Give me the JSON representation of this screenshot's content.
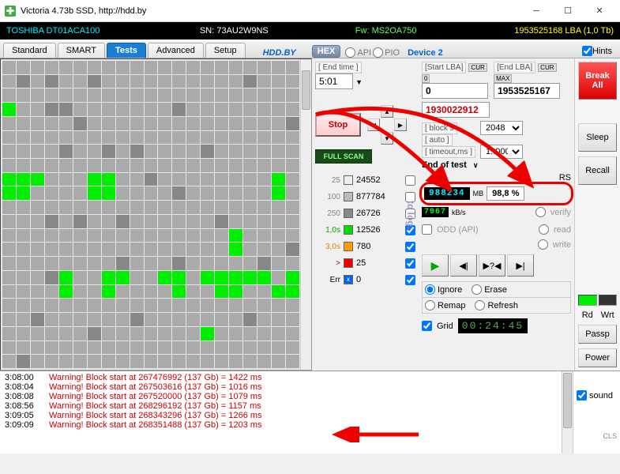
{
  "window": {
    "title": "Victoria 4.73b SSD, http://hdd.by"
  },
  "drive": {
    "model": "TOSHIBA DT01ACA100",
    "sn_label": "SN:",
    "sn": "73AU2W9NS",
    "fw_label": "Fw:",
    "fw": "MS2OA750",
    "lba": "1953525168 LBA (1,0 Tb)"
  },
  "tabs": {
    "standard": "Standard",
    "smart": "SMART",
    "tests": "Tests",
    "advanced": "Advanced",
    "setup": "Setup"
  },
  "top": {
    "hdd_by": "HDD.BY",
    "hex": "HEX",
    "api": "API",
    "pio": "PIO",
    "device": "Device 2",
    "hints": "Hints"
  },
  "scan": {
    "start_lba_label": "[Start LBA]",
    "end_lba_label": "[End LBA]",
    "end_time_label": "[ End time ]",
    "end_time": "5:01",
    "start_lba": "0",
    "end_lba": "1953525167",
    "pos_lba": "1930022912",
    "cur": "CUR",
    "zero": "0",
    "max": "MAX",
    "block_label": "[ block s",
    "auto_label": "[ auto ]",
    "timeout_label": "[ timeout,ms ]",
    "block": "2048",
    "timeout": "1..000",
    "stop": "Stop",
    "full_scan": "FULL SCAN",
    "end_of_test": "End of test"
  },
  "stats": {
    "l25": {
      "label": "25",
      "value": "24552"
    },
    "l100": {
      "label": "100",
      "value": "877784"
    },
    "l250": {
      "label": "250",
      "value": "26726"
    },
    "l1s": {
      "label": "1,0s",
      "value": "12526"
    },
    "l3s": {
      "label": "3,0s",
      "value": "780"
    },
    "lgt": {
      "label": ">",
      "value": "25"
    },
    "lerr": {
      "label": "Err",
      "value": "0"
    },
    "tolog": "to log:",
    "rs": "RS"
  },
  "result": {
    "mb": "988234",
    "mb_unit": "MB",
    "percent": "98,8  %",
    "kbs": "7967",
    "kbs_unit": "kB/s"
  },
  "opts": {
    "verify": "verify",
    "read": "read",
    "write": "write",
    "odd": "ODD (API)",
    "ignore": "Ignore",
    "erase": "Erase",
    "remap": "Remap",
    "refresh": "Refresh",
    "grid": "Grid",
    "timer": "00:24:45"
  },
  "side": {
    "break": "Break",
    "all": "All",
    "sleep": "Sleep",
    "recall": "Recall",
    "passp": "Passp",
    "power": "Power",
    "rd": "Rd",
    "wrt": "Wrt",
    "sound": "sound",
    "cls": "CLS"
  },
  "log": [
    {
      "t": "3:08:00",
      "m": "Warning! Block start at 267476992 (137 Gb)  = 1422 ms"
    },
    {
      "t": "3:08:04",
      "m": "Warning! Block start at 267503616 (137 Gb)  = 1016 ms"
    },
    {
      "t": "3:08:08",
      "m": "Warning! Block start at 267520000 (137 Gb)  = 1079 ms"
    },
    {
      "t": "3:08:56",
      "m": "Warning! Block start at 268296192 (137 Gb)  = 1157 ms"
    },
    {
      "t": "3:09:05",
      "m": "Warning! Block start at 268343296 (137 Gb)  = 1266 ms"
    },
    {
      "t": "3:09:09",
      "m": "Warning! Block start at 268351488 (137 Gb)  = 1203 ms"
    }
  ],
  "grid_colors": [
    "mmmmmmmmmmmmmmmmmmmmm",
    "mdmdmmdmmmmmmmmmmdmmm",
    "mmmmmmmmmmmmmmmmmmmmm",
    "gmmddmmmmmmmdmmmmmmmm",
    "mmmmmdmmmmmmmmmmmmmmd",
    "mmmmmmmmmmmmmmmmmmmmm",
    "mmmmdmmdmdmmmmdmmmmmm",
    "mmmmmmmmmmmmmmmmmmmmm",
    "gggmmmggmmdmmmmmmmmgm",
    "ggmmmmggmmmmdmmmmmmgm",
    "mmmmmmmmmmmmmmmmmmmmm",
    "mmmdmdmmdmmmmmmdmmmmm",
    "mmmmmmmmmmmmmmmmgmmmm",
    "mmmmmmmmmmmmmmmmgmmmd",
    "mmmmmmmmdmmmdmmmmmdmm",
    "mmmdgmmggmmggmgggggmg",
    "mmmmgmmgmmmmgmmggmmgg",
    "mmmmmmmmmmmmmmmmmmmmm",
    "mmdmmmmmmdmmmmmmmdmmm",
    "mmmmmmdmmmmmmmgmmmmmm",
    "mmmmmmmmmmmmmmmmmmmmm",
    "mdmmmmmmmmmmmmmmmmmmm"
  ]
}
